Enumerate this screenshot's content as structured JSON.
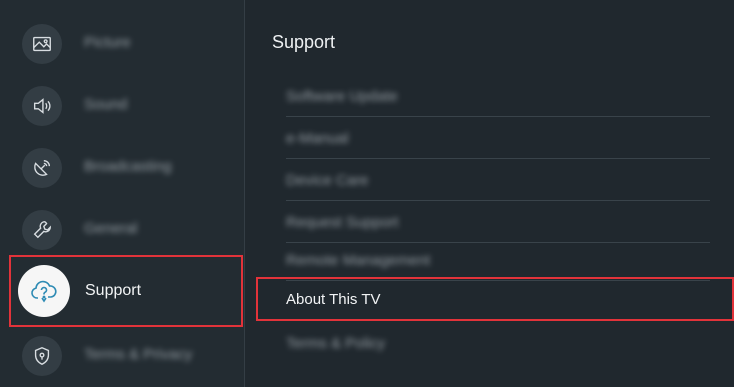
{
  "sidebar": {
    "items": [
      {
        "label": "Picture",
        "icon": "picture-icon"
      },
      {
        "label": "Sound",
        "icon": "sound-icon"
      },
      {
        "label": "Broadcasting",
        "icon": "broadcasting-icon"
      },
      {
        "label": "General",
        "icon": "wrench-icon"
      },
      {
        "label": "Support",
        "icon": "support-cloud-icon"
      },
      {
        "label": "Terms & Privacy",
        "icon": "shield-icon"
      }
    ],
    "selected": "Support"
  },
  "panel": {
    "title": "Support",
    "items": [
      {
        "label": "Software Update"
      },
      {
        "label": "e-Manual"
      },
      {
        "label": "Device Care"
      },
      {
        "label": "Request Support"
      },
      {
        "label": "Remote Management"
      },
      {
        "label": "About This TV"
      },
      {
        "label": "Terms & Policy"
      }
    ],
    "selected": "About This TV"
  },
  "colors": {
    "background": "#20282e",
    "focus_outline": "#e2333a",
    "text": "#f2f4f5"
  }
}
